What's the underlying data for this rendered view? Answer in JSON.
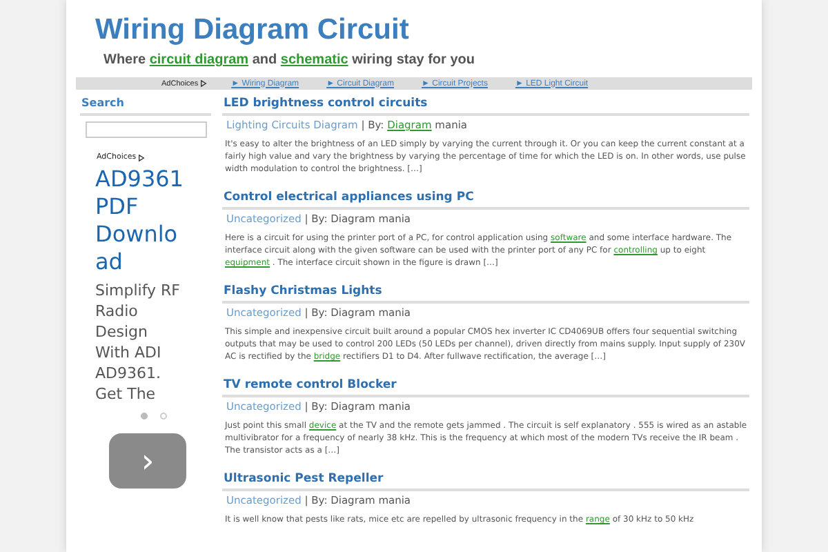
{
  "header": {
    "title": "Wiring Diagram Circuit",
    "tagline": [
      {
        "kind": "text",
        "text": "Where "
      },
      {
        "kind": "link",
        "text": "circuit diagram"
      },
      {
        "kind": "text",
        "text": " and "
      },
      {
        "kind": "link",
        "text": "schematic"
      },
      {
        "kind": "text",
        "text": " wiring stay for you"
      }
    ]
  },
  "nav": {
    "adchoices": "AdChoices",
    "links": [
      "► Wiring Diagram",
      "► Circuit Diagram",
      "► Circuit Projects",
      "► LED Light Circuit"
    ]
  },
  "sidebar": {
    "search_title": "Search",
    "ad": {
      "adchoices": "AdChoices",
      "headline": "AD9361 PDF Download",
      "text": "Simplify RF Radio Design With ADI AD9361. Get The",
      "dots": [
        {
          "selected": true
        },
        {
          "selected": false
        }
      ],
      "next": "›"
    }
  },
  "posts": [
    {
      "title": "LED brightness control circuits",
      "meta": [
        {
          "kind": "category",
          "text": "Lighting Circuits Diagram"
        },
        {
          "kind": "text",
          "text": " | By: "
        },
        {
          "kind": "link",
          "text": "Diagram"
        },
        {
          "kind": "text",
          "text": " mania"
        }
      ],
      "body": [
        {
          "kind": "text",
          "text": "It's easy to alter the brightness of an LED simply by varying the current through it. Or you can keep the current constant at a fairly high value and vary the brightness by varying the percentage of time for which the LED is on. In other words, use pulse width modulation to control the brightness. […]"
        }
      ]
    },
    {
      "title": "Control electrical appliances using PC",
      "meta": [
        {
          "kind": "category",
          "text": "Uncategorized"
        },
        {
          "kind": "text",
          "text": " | By: Diagram mania"
        }
      ],
      "body": [
        {
          "kind": "text",
          "text": "Here is a circuit for using the printer port of a PC, for control application using "
        },
        {
          "kind": "link",
          "text": "software"
        },
        {
          "kind": "text",
          "text": " and some interface hardware. The interface circuit along with the given software can be used with the printer port of any PC for "
        },
        {
          "kind": "link",
          "text": "controlling"
        },
        {
          "kind": "text",
          "text": " up to eight "
        },
        {
          "kind": "link",
          "text": "equipment"
        },
        {
          "kind": "text",
          "text": " . The interface circuit shown in the figure is drawn […]"
        }
      ]
    },
    {
      "title": "Flashy Christmas Lights",
      "meta": [
        {
          "kind": "category",
          "text": "Uncategorized"
        },
        {
          "kind": "text",
          "text": " | By: Diagram mania"
        }
      ],
      "body": [
        {
          "kind": "text",
          "text": " This simple and inexpensive circuit built around a popular CMOS hex inverter IC CD4069UB offers four sequential switching outputs that may be used to control 200 LEDs (50 LEDs per channel), driven directly from mains supply. Input supply of 230V AC is rectified by the "
        },
        {
          "kind": "link",
          "text": "bridge"
        },
        {
          "kind": "text",
          "text": " rectifiers D1 to D4. After fullwave rectification, the average […]"
        }
      ]
    },
    {
      "title": "TV remote control Blocker",
      "meta": [
        {
          "kind": "category",
          "text": "Uncategorized"
        },
        {
          "kind": "text",
          "text": " | By: Diagram mania"
        }
      ],
      "body": [
        {
          "kind": "text",
          "text": "Just point this small "
        },
        {
          "kind": "link",
          "text": "device"
        },
        {
          "kind": "text",
          "text": " at the TV and the remote gets jammed .   The circuit is self explanatory . 555 is wired as an astable multivibrator for a frequency of nearly 38 kHz. This is the frequency at which most of the modern TVs receive the IR beam . The transistor acts as a […]"
        }
      ]
    },
    {
      "title": "Ultrasonic Pest Repeller",
      "meta": [
        {
          "kind": "category",
          "text": "Uncategorized"
        },
        {
          "kind": "text",
          "text": " | By: Diagram mania"
        }
      ],
      "body": [
        {
          "kind": "text",
          "text": "It is well know that pests like rats, mice etc are repelled by ultrasonic frequency in the "
        },
        {
          "kind": "link",
          "text": "range"
        },
        {
          "kind": "text",
          "text": " of 30 kHz to 50 kHz"
        }
      ]
    }
  ]
}
